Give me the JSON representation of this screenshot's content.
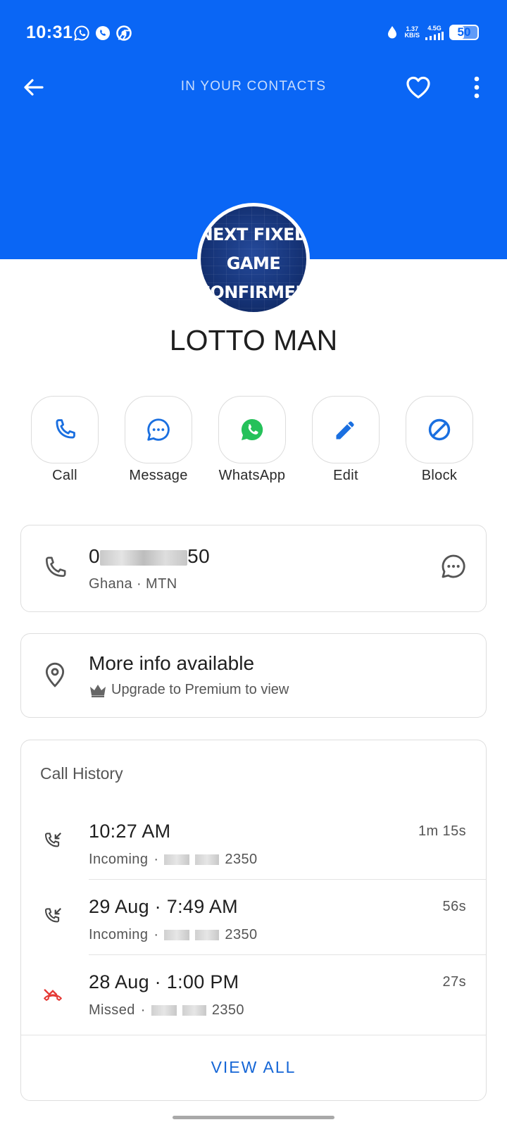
{
  "status_bar": {
    "time": "10:31",
    "notification_icons": [
      "whatsapp-icon",
      "viber-icon",
      "chrome-icon"
    ],
    "data_saver_icon": "water-drop-icon",
    "net_speed_value": "1.37",
    "net_speed_unit": "KB/S",
    "network_type": "4.5G",
    "battery_level": "50",
    "battery_fraction": 0.5
  },
  "app_bar": {
    "title": "IN YOUR CONTACTS",
    "back_icon": "arrow-left-icon",
    "favorite_icon": "heart-outline-icon",
    "more_icon": "more-vertical-icon"
  },
  "contact": {
    "name": "LOTTO MAN",
    "avatar_lines": [
      "NEXT FIXED",
      "GAME",
      "CONFIRMED"
    ]
  },
  "actions": [
    {
      "label": "Call",
      "icon": "phone-icon"
    },
    {
      "label": "Message",
      "icon": "message-bubble-icon"
    },
    {
      "label": "WhatsApp",
      "icon": "whatsapp-icon"
    },
    {
      "label": "Edit",
      "icon": "pencil-icon"
    },
    {
      "label": "Block",
      "icon": "block-icon"
    }
  ],
  "phone_card": {
    "number_prefix": "0",
    "number_suffix": "50",
    "meta": "Ghana · MTN"
  },
  "info_card": {
    "title": "More info available",
    "subtitle": "Upgrade to Premium to view"
  },
  "call_history": {
    "title": "Call History",
    "calls": [
      {
        "time": "10:27 AM",
        "type": "Incoming",
        "number_suffix": "2350",
        "duration": "1m 15s",
        "icon": "incoming-call-icon"
      },
      {
        "time": "29 Aug · 7:49 AM",
        "type": "Incoming",
        "number_suffix": "2350",
        "duration": "56s",
        "icon": "incoming-call-icon"
      },
      {
        "time": "28 Aug · 1:00 PM",
        "type": "Missed",
        "number_suffix": "2350",
        "duration": "27s",
        "icon": "missed-call-icon"
      }
    ],
    "view_all": "VIEW ALL"
  },
  "colors": {
    "header_blue": "#0a66f5",
    "action_blue": "#1a6fe0",
    "whatsapp_green": "#25c15a",
    "missed_red": "#e53935",
    "link_blue": "#1566d6"
  }
}
